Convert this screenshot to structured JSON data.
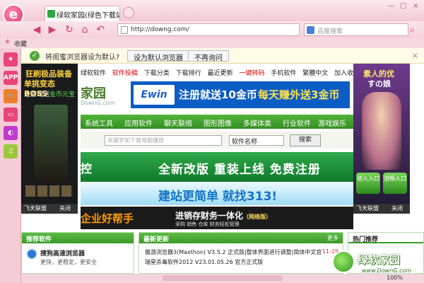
{
  "browser": {
    "tab_title": "绿软家园(绿色下载站) | 打造",
    "tab_close": "×",
    "window_controls": [
      "—",
      "□",
      "×"
    ],
    "url": "http://downg.com/",
    "search_placeholder": "百度搜索",
    "favorites_label": "收藏",
    "status_zoom": "100%"
  },
  "notification": {
    "message": "将闺蜜浏览器设为默认?",
    "set_default_label": "设为默认浏览器",
    "dont_ask_label": "不再询问",
    "close": "×"
  },
  "sidebar": {
    "items": [
      {
        "icon": "star-icon",
        "label": "★",
        "color": "#e8457a"
      },
      {
        "icon": "app-icon",
        "label": "APP",
        "color": "#e8457a"
      },
      {
        "icon": "cart-icon",
        "label": "🛒",
        "color": "#f07f2a"
      },
      {
        "icon": "card-icon",
        "label": "▭",
        "color": "#e8457a"
      },
      {
        "icon": "game-icon",
        "label": "◐",
        "color": "#c03ad0"
      },
      {
        "icon": "music-icon",
        "label": "♫",
        "color": "#9ac93a"
      }
    ]
  },
  "site": {
    "top_links": [
      "绿软软件",
      "软件投稿",
      "下载分类",
      "下载排行",
      "最近更新",
      "一键转码",
      "手机软件",
      "繁體中文",
      "加入收藏"
    ],
    "logo_text": "家园",
    "logo_sub": "DownG.com",
    "banner1": {
      "logo": "Ewin",
      "text1": "注册就送10金币",
      "text2": "每天赚外送3金币"
    },
    "green_nav": [
      "系统工具",
      "应用软件",
      "聊天联络",
      "图形图像",
      "多媒体类",
      "行业软件",
      "游戏娱乐"
    ],
    "search_placeholder": "关键字如下载电脑播放",
    "search_select": "软件名称",
    "search_button": "搜索",
    "banner2": {
      "left": "控",
      "text": "全新改版  重装上线  免费注册"
    },
    "banner3": {
      "text": "建站更简单  就找313!"
    },
    "banner4": {
      "left": "企业好帮手",
      "mid": "进销存财务一体化",
      "mid_suffix": "（网络版）",
      "sub": "采购 销售 仓库 财务轻松管理"
    }
  },
  "left_ad": {
    "title1": "狂刷极品装备",
    "title2": "单挑变态BOSS",
    "line3_a": "进游戏送",
    "line3_b": "金币元宝",
    "footer_left": "飞天联盟",
    "footer_close": "关闭"
  },
  "right_ad": {
    "title1": "素人的优",
    "title2": "すの娘",
    "btn1": "进入入口",
    "btn2": "流畅入口",
    "footer_left": "飞天联盟",
    "footer_close": "关闭"
  },
  "sections": {
    "recommend": {
      "title": "推荐软件",
      "item": "搜狗高速浏览器",
      "sub": "更快，更稳定，更安全"
    },
    "latest": {
      "title": "最新更新",
      "more": "更多",
      "items": [
        "傲游浏览器3(Maxthon) V3.5.2 正式版|整体界面进行调整|简体中文官",
        "瑞星杀毒软件2012 V23.01.05.26 官方正式版"
      ],
      "date": "11-29"
    },
    "hot": {
      "title": "热门推荐"
    }
  },
  "watermark": {
    "text": "绿软家园",
    "url": "www.DownG.com"
  }
}
